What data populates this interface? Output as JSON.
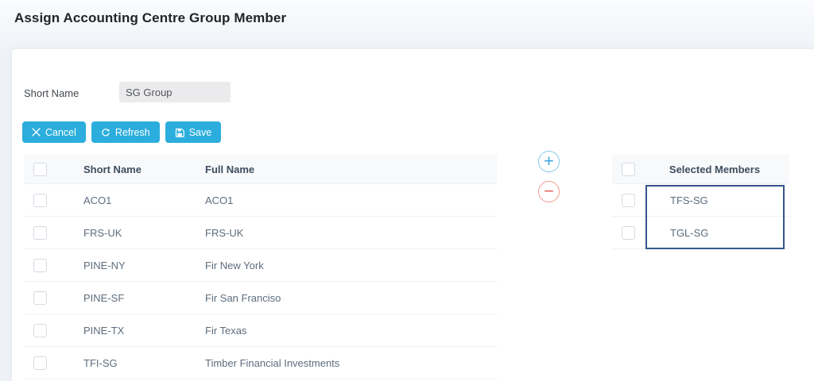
{
  "page": {
    "title": "Assign Accounting Centre Group Member"
  },
  "form": {
    "short_name_label": "Short Name",
    "short_name_value": "SG Group"
  },
  "toolbar": {
    "cancel_label": "Cancel",
    "refresh_label": "Refresh",
    "save_label": "Save"
  },
  "icons": {
    "cancel": "✕",
    "refresh": "⟳",
    "save": "💾",
    "add": "+",
    "remove": "−"
  },
  "available_table": {
    "columns": [
      "Short Name",
      "Full Name"
    ],
    "rows": [
      {
        "short_name": "ACO1",
        "full_name": "ACO1"
      },
      {
        "short_name": "FRS-UK",
        "full_name": "FRS-UK"
      },
      {
        "short_name": "PINE-NY",
        "full_name": "Fir New York"
      },
      {
        "short_name": "PINE-SF",
        "full_name": "Fir San Franciso"
      },
      {
        "short_name": "PINE-TX",
        "full_name": "Fir Texas"
      },
      {
        "short_name": "TFI-SG",
        "full_name": "Timber Financial Investments"
      }
    ]
  },
  "selected_table": {
    "header": "Selected Members",
    "rows": [
      {
        "name": "TFS-SG"
      },
      {
        "name": "TGL-SG"
      }
    ]
  },
  "colors": {
    "accent": "#2BAEDD",
    "add": "#2E9FD6",
    "remove": "#E25B4E",
    "selection_border": "#35548C"
  }
}
